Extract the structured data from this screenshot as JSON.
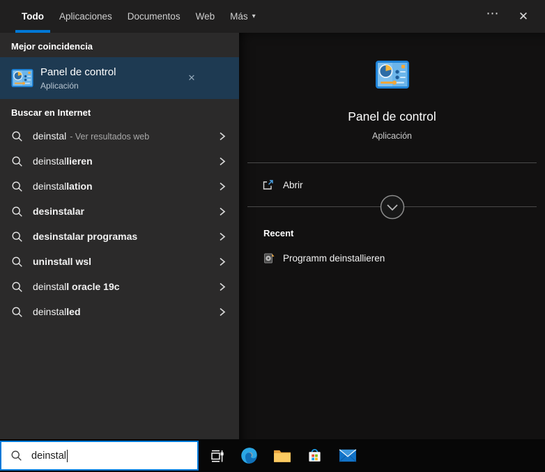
{
  "colors": {
    "accent": "#0078d7",
    "highlight": "#1e3a52"
  },
  "icons": {
    "ellipsis": "⋯",
    "close": "✕",
    "caret_down": "▾",
    "remove_x": "✕"
  },
  "tabs": {
    "items": [
      {
        "label": "Todo",
        "active": true
      },
      {
        "label": "Aplicaciones",
        "active": false
      },
      {
        "label": "Documentos",
        "active": false
      },
      {
        "label": "Web",
        "active": false
      },
      {
        "label": "Más",
        "active": false,
        "has_dropdown": true
      }
    ]
  },
  "best_match": {
    "section_title": "Mejor coincidencia",
    "item": {
      "title": "Panel de control",
      "subtitle": "Aplicación",
      "icon": "control-panel-icon"
    }
  },
  "search_suggestions": {
    "section_title": "Buscar en Internet",
    "items": [
      {
        "prefix": "deinstal",
        "completion": "",
        "annotation": "- Ver resultados web"
      },
      {
        "prefix": "deinstal",
        "completion": "lieren"
      },
      {
        "prefix": "deinstal",
        "completion": "lation"
      },
      {
        "prefix": "",
        "completion": "desinstalar"
      },
      {
        "prefix": "",
        "completion": "desinstalar programas"
      },
      {
        "prefix": "",
        "completion": "uninstall wsl"
      },
      {
        "prefix": "deinstal",
        "completion": "l oracle 19c"
      },
      {
        "prefix": "deinstal",
        "completion": "led"
      }
    ]
  },
  "preview": {
    "app_title": "Panel de control",
    "app_subtitle": "Aplicación",
    "app_icon": "control-panel-icon",
    "actions": [
      {
        "label": "Abrir",
        "icon": "open-external-icon"
      }
    ],
    "recent": {
      "section_title": "Recent",
      "items": [
        {
          "label": "Programm deinstallieren",
          "icon": "uninstall-program-icon"
        }
      ]
    }
  },
  "taskbar": {
    "search": {
      "value": "deinstal",
      "icon": "search-icon"
    },
    "buttons": [
      "task-view",
      "edge",
      "file-explorer",
      "store",
      "mail"
    ]
  }
}
